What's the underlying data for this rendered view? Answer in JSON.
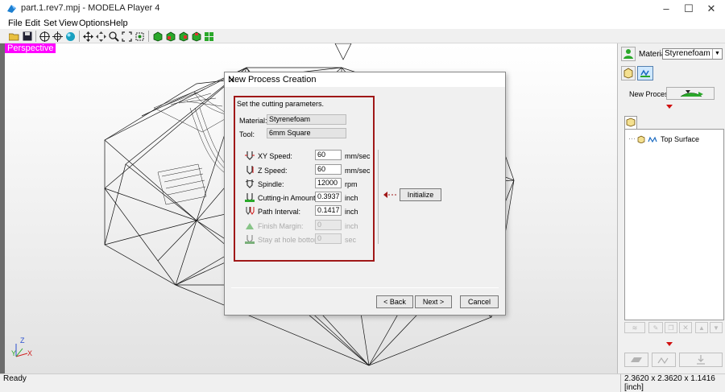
{
  "window": {
    "title": "part.1.rev7.mpj - MODELA Player 4"
  },
  "menu": [
    "File",
    "Edit",
    "Set",
    "View",
    "Options",
    "Help"
  ],
  "viewport": {
    "label": "Perspective"
  },
  "dialog": {
    "title": "New Process Creation",
    "instruction": "Set the cutting parameters.",
    "material_label": "Material:",
    "material_value": "Styrenefoam",
    "tool_label": "Tool:",
    "tool_value": "6mm Square",
    "params": [
      {
        "label": "XY Speed:",
        "value": "60",
        "unit": "mm/sec",
        "enabled": true
      },
      {
        "label": "Z Speed:",
        "value": "60",
        "unit": "mm/sec",
        "enabled": true
      },
      {
        "label": "Spindle:",
        "value": "12000",
        "unit": "rpm",
        "enabled": true
      },
      {
        "label": "Cutting-in Amount:",
        "value": "0.3937",
        "unit": "inch",
        "enabled": true
      },
      {
        "label": "Path Interval:",
        "value": "0.1417",
        "unit": "inch",
        "enabled": true
      },
      {
        "label": "Finish Margin:",
        "value": "0",
        "unit": "inch",
        "enabled": false
      },
      {
        "label": "Stay at hole bottom:",
        "value": "0",
        "unit": "sec",
        "enabled": false
      }
    ],
    "initialize_label": "Initialize",
    "back_label": "< Back",
    "next_label": "Next >",
    "cancel_label": "Cancel"
  },
  "right_panel": {
    "material_label": "Material",
    "material_value": "Styrenefoam",
    "new_process_label": "New Process",
    "tree_item": "Top Surface"
  },
  "axis": {
    "z": "Z",
    "y": "Y",
    "x": "X"
  },
  "status": {
    "left": "Ready",
    "right": "2.3620 x 2.3620 x 1.1416 [inch]"
  },
  "colors": {
    "accent_magenta": "#ff00ff",
    "highlight_red": "#a01818",
    "arrow_red": "#d01010"
  }
}
